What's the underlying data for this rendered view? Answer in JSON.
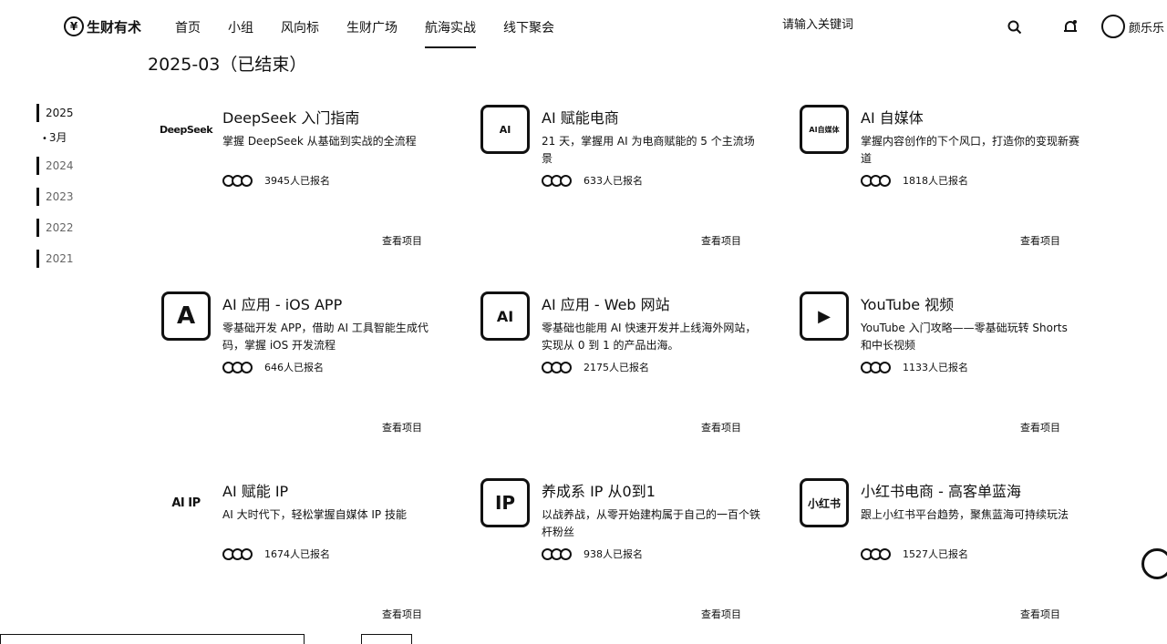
{
  "nav": {
    "logo": "生财有术",
    "links": [
      "首页",
      "小组",
      "风向标",
      "生财广场",
      "航海实战",
      "线下聚会"
    ],
    "active_index": 4,
    "search_placeholder": "请输入关键词",
    "user_name": "颜乐乐"
  },
  "page_title": "2025-03（已结束）",
  "years": {
    "current": "2025",
    "month": "3月",
    "others": [
      "2024",
      "2023",
      "2022",
      "2021"
    ]
  },
  "cards": [
    {
      "title": "DeepSeek 入门指南",
      "desc": "掌握 DeepSeek 从基础到实战的全流程",
      "count": "3945人已报名",
      "link": "查看项目",
      "thumb": "DeepSeek"
    },
    {
      "title": "AI 赋能电商",
      "desc": "21 天，掌握用 AI 为电商赋能的 5 个主流场景",
      "count": "633人已报名",
      "link": "查看项目",
      "thumb": "AI"
    },
    {
      "title": "AI 自媒体",
      "desc": "掌握内容创作的下个风口，打造你的变现新赛道",
      "count": "1818人已报名",
      "link": "查看项目",
      "thumb": "AI自媒体"
    },
    {
      "title": "AI 应用 - iOS APP",
      "desc": "零基础开发 APP，借助 AI 工具智能生成代码，掌握 iOS 开发流程",
      "count": "646人已报名",
      "link": "查看项目",
      "thumb": "A"
    },
    {
      "title": "AI 应用 - Web 网站",
      "desc": "零基础也能用 AI 快速开发并上线海外网站，实现从 0 到 1 的产品出海。",
      "count": "2175人已报名",
      "link": "查看项目",
      "thumb": "AI"
    },
    {
      "title": "YouTube 视频",
      "desc": "YouTube 入门攻略——零基础玩转 Shorts 和中长视频",
      "count": "1133人已报名",
      "link": "查看项目",
      "thumb": "▶"
    },
    {
      "title": "AI 赋能 IP",
      "desc": "AI 大时代下，轻松掌握自媒体 IP 技能",
      "count": "1674人已报名",
      "link": "查看项目",
      "thumb": "AI IP"
    },
    {
      "title": "养成系 IP 从0到1",
      "desc": "以战养战，从零开始建构属于自己的一百个铁杆粉丝",
      "count": "938人已报名",
      "link": "查看项目",
      "thumb": "IP"
    },
    {
      "title": "小红书电商 - 高客单蓝海",
      "desc": "跟上小红书平台趋势，聚焦蓝海可持续玩法",
      "count": "1527人已报名",
      "link": "查看项目",
      "thumb": "小红书"
    }
  ]
}
